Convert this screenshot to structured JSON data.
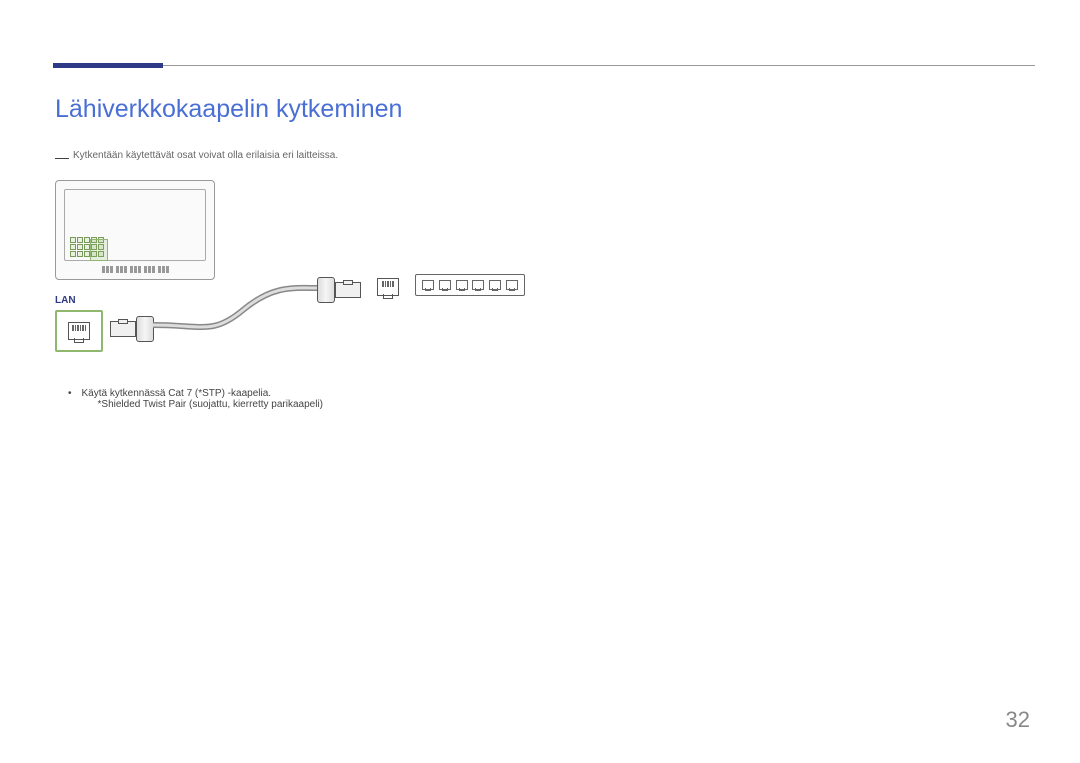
{
  "page": {
    "title": "Lähiverkkokaapelin kytkeminen",
    "note": "Kytkentään käytettävät osat voivat olla erilaisia eri laitteissa.",
    "lan_label": "LAN",
    "bullet1": "Käytä kytkennässä Cat 7 (*STP) -kaapelia.",
    "bullet1_sub": "*Shielded Twist Pair (suojattu, kierretty parikaapeli)",
    "page_number": "32"
  }
}
